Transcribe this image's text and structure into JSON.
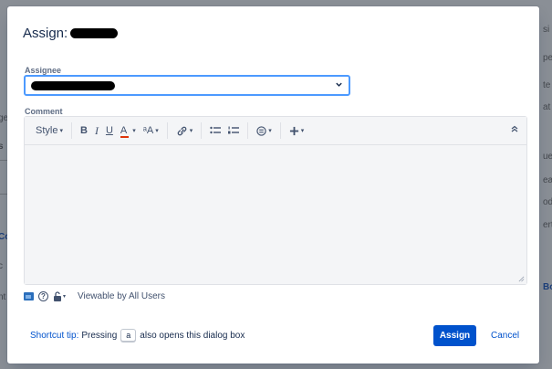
{
  "dialog": {
    "title": "Assign:",
    "assignee_label": "Assignee",
    "comment_label": "Comment",
    "viewable_text": "Viewable by All Users",
    "shortcut_tip_link": "Shortcut tip:",
    "shortcut_tip_before": "Pressing",
    "shortcut_key": "a",
    "shortcut_tip_after": "also opens this dialog box",
    "assign_label": "Assign",
    "cancel_label": "Cancel"
  },
  "toolbar": {
    "style_label": "Style",
    "bold": "B",
    "italic": "I",
    "underline": "U",
    "text_color": "A",
    "text_size": "ᵃA"
  },
  "background": {
    "left": [
      ":",
      "ge",
      "s",
      "Co",
      "c",
      "nt"
    ],
    "right": [
      "si",
      "pe",
      "te",
      "at",
      "ue",
      "ea",
      "od",
      "ert",
      "Bo"
    ]
  },
  "colors": {
    "primary": "#0052cc",
    "focus_border": "#4c9aff",
    "text_color_bar": "#de350b"
  }
}
